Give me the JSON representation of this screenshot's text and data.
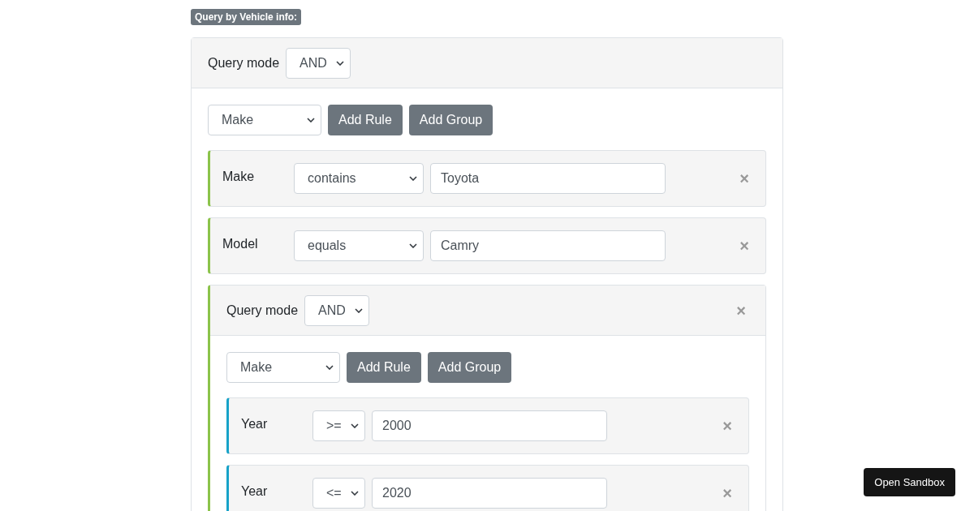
{
  "heading": "Query by Vehicle info:",
  "query": {
    "mode_label": "Query mode",
    "mode": "AND",
    "field": "Make",
    "add_rule": "Add Rule",
    "add_group": "Add Group",
    "children": [
      {
        "kind": "rule",
        "field": "Make",
        "operator": "contains",
        "value": "Toyota",
        "remove": "×"
      },
      {
        "kind": "rule",
        "field": "Model",
        "operator": "equals",
        "value": "Camry",
        "remove": "×"
      },
      {
        "kind": "group",
        "mode_label": "Query mode",
        "mode": "AND",
        "field": "Make",
        "add_rule": "Add Rule",
        "add_group": "Add Group",
        "remove": "×",
        "children": [
          {
            "kind": "rule",
            "field": "Year",
            "operator": ">=",
            "value": "2000",
            "remove": "×"
          },
          {
            "kind": "rule",
            "field": "Year",
            "operator": "<=",
            "value": "2020",
            "remove": "×"
          }
        ]
      }
    ]
  },
  "sandbox_button": "Open Sandbox"
}
